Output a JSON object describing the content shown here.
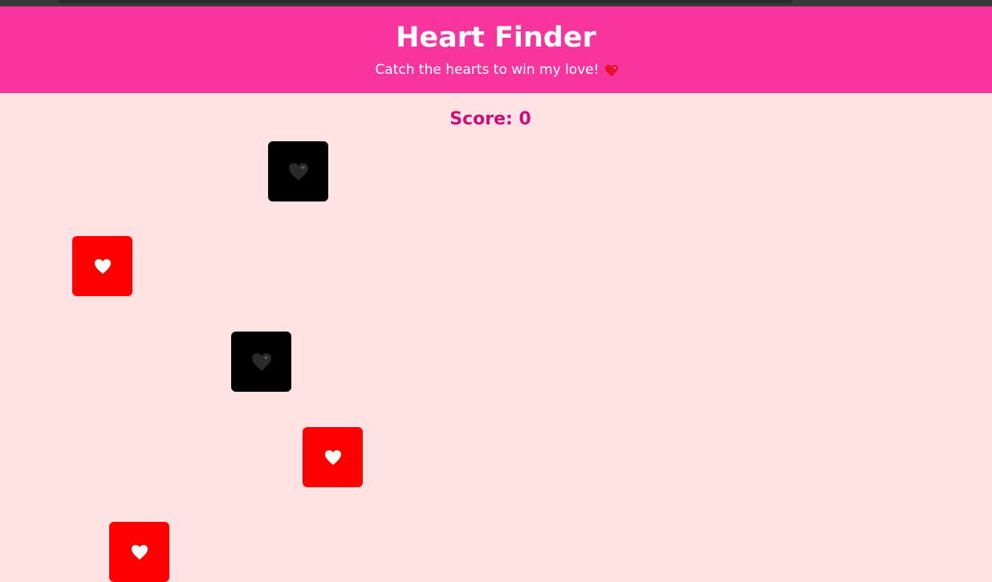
{
  "app": {
    "title": "Heart Finder",
    "subtitle": "Catch the hearts to win my love!",
    "subtitle_icon": "red-heart-emoji"
  },
  "score": {
    "label": "Score: 0",
    "value": 0
  },
  "colors": {
    "header": "#f7359d",
    "background": "#ffe3e4",
    "score_text": "#cc0f77",
    "red_card": "#ff0000",
    "black_card": "#000000"
  },
  "cards": [
    {
      "kind": "black",
      "icon": "black-heart-icon"
    },
    {
      "kind": "red",
      "icon": "white-heart-icon"
    },
    {
      "kind": "black",
      "icon": "black-heart-icon"
    },
    {
      "kind": "red",
      "icon": "white-heart-icon"
    },
    {
      "kind": "red",
      "icon": "white-heart-icon"
    }
  ]
}
